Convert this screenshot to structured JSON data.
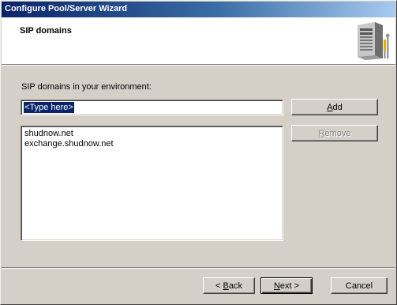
{
  "window": {
    "title": "Configure Pool/Server Wizard"
  },
  "header": {
    "page_title": "SIP domains",
    "icon": "server-tools-icon"
  },
  "form": {
    "label": "SIP domains in your environment:",
    "input_value": "<Type here>",
    "domains": [
      "shudnow.net",
      "exchange.shudnow.net"
    ]
  },
  "buttons": {
    "add": {
      "mnemonic": "A",
      "rest": "dd"
    },
    "remove": {
      "mnemonic": "R",
      "rest": "emove"
    },
    "back": {
      "prefix": "< ",
      "mnemonic": "B",
      "rest": "ack"
    },
    "next": {
      "mnemonic": "N",
      "rest": "ext >"
    },
    "cancel": "Cancel"
  },
  "colors": {
    "titlebar_start": "#0a246a",
    "titlebar_end": "#a6caf0",
    "selection": "#0a246a",
    "face": "#d4d0c8"
  }
}
